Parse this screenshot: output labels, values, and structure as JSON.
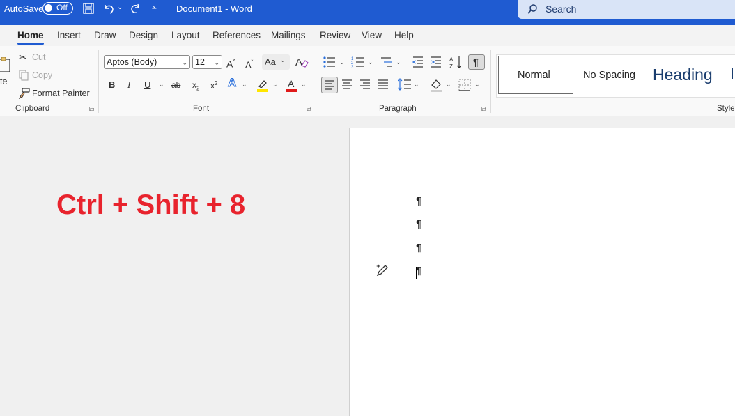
{
  "titlebar": {
    "autosave_label": "AutoSave",
    "autosave_state": "Off",
    "document_title": "Document1  -  Word",
    "search_label": "Search"
  },
  "tabs": [
    "Home",
    "Insert",
    "Draw",
    "Design",
    "Layout",
    "References",
    "Mailings",
    "Review",
    "View",
    "Help"
  ],
  "clipboard": {
    "paste_fragment": "te",
    "cut": "Cut",
    "copy": "Copy",
    "format_painter": "Format Painter",
    "group_label": "Clipboard"
  },
  "font": {
    "font_name": "Aptos (Body)",
    "font_size": "12",
    "change_case": "Aa",
    "group_label": "Font"
  },
  "paragraph": {
    "group_label": "Paragraph"
  },
  "styles": {
    "items": [
      "Normal",
      "No Spacing",
      "Heading"
    ],
    "group_label": "Styles"
  },
  "overlay": {
    "shortcut": "Ctrl + Shift + 8"
  },
  "document": {
    "pilcrow": "¶"
  },
  "colors": {
    "title_bar": "#1f5bd1",
    "shortcut_text": "#e8232d",
    "highlight": "#ffe600",
    "font_color": "#e01b1b"
  }
}
